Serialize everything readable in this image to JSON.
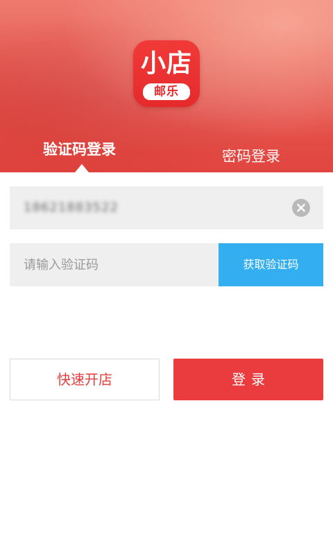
{
  "app": {
    "logo_text_top": "小店",
    "logo_text_bottom": "邮乐"
  },
  "tabs": {
    "sms_login": "验证码登录",
    "password_login": "密码登录",
    "active": "sms_login"
  },
  "form": {
    "phone_value": "18621883522",
    "code_placeholder": "请输入验证码",
    "get_code_label": "获取验证码"
  },
  "actions": {
    "open_shop_label": "快速开店",
    "login_label": "登录"
  },
  "colors": {
    "brand_red": "#ea3c3f",
    "accent_blue": "#33aef0",
    "input_bg": "#efefef"
  },
  "icons": {
    "clear": "clear-circle-icon"
  }
}
